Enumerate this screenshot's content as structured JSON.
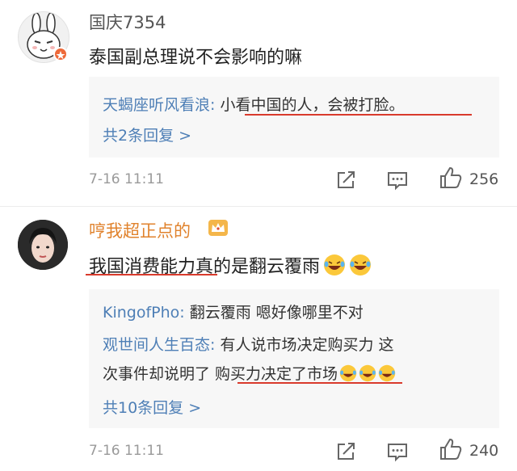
{
  "comments": [
    {
      "username": "国庆7354",
      "text": "泰国副总理说不会影响的嘛",
      "replies": [
        {
          "name": "天蝎座听风看浪",
          "sep": ": ",
          "text": "小看中国的人，会被打脸。"
        }
      ],
      "more_replies": "共2条回复 >",
      "time": "7-16 11:11",
      "likes": "256"
    },
    {
      "username": "哼我超正点的",
      "text": "我国消费能力真的是翻云覆雨",
      "replies": [
        {
          "name": "KingofPho",
          "sep": ": ",
          "text": "翻云覆雨 嗯好像哪里不对"
        },
        {
          "name": "观世间人生百态",
          "sep": ": ",
          "text": "有人说市场决定购买力  这",
          "text2a": "次事件却说明了 ",
          "text2b": "购买力决定了市场"
        }
      ],
      "more_replies": "共10条回复 >",
      "time": "7-16 11:11",
      "likes": "240"
    }
  ],
  "colors": {
    "username_orange": "#e0822c",
    "reply_name_blue": "#4e7fb6",
    "underline_red": "#d93a2c",
    "badge_orange": "#ee6a3a"
  },
  "icons": [
    "share-icon",
    "comment-icon",
    "like-icon",
    "crown-badge-icon",
    "laughing-emoji-icon"
  ]
}
